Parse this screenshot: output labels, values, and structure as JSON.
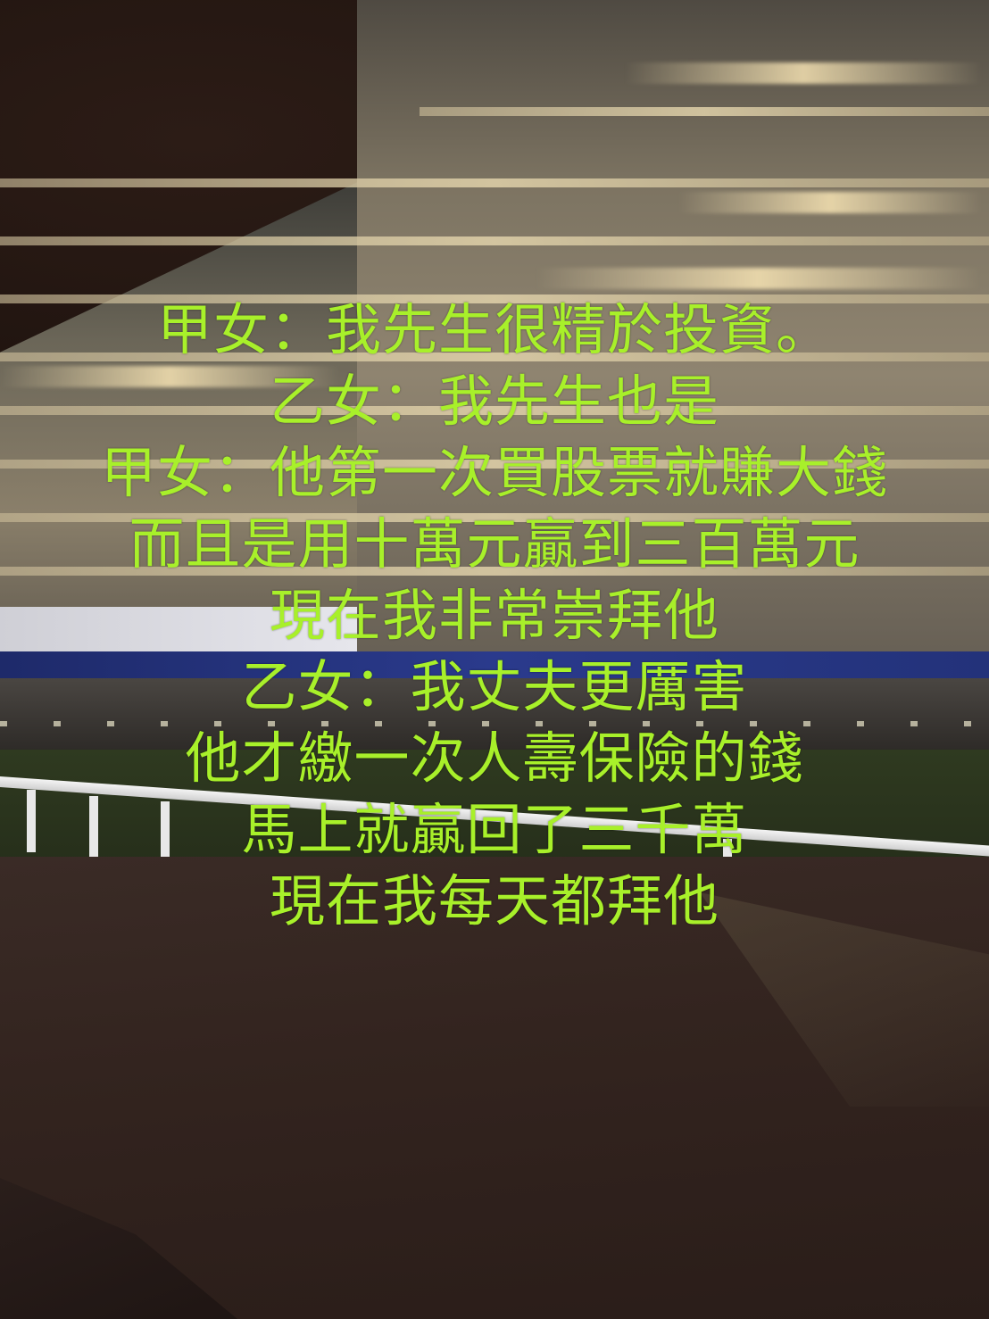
{
  "caption": {
    "color": "#a8f02a",
    "lines": [
      "甲女：我先生很精於投資。",
      "乙女：我先生也是",
      "甲女：他第一次買股票就賺大錢",
      "而且是用十萬元贏到三百萬元",
      "現在我非常崇拜他",
      "乙女：我丈夫更厲害",
      "他才繳一次人壽保險的錢",
      "馬上就贏回了三千萬",
      "現在我每天都拜他"
    ]
  }
}
